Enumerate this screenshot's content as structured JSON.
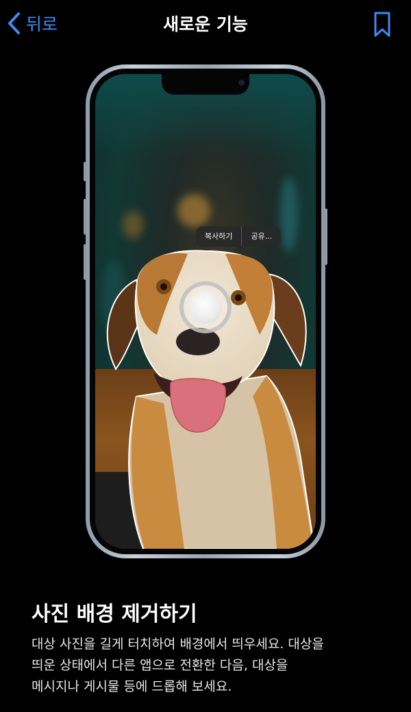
{
  "nav": {
    "back_label": "뒤로",
    "title": "새로운 기능",
    "back_icon": "chevron-left-icon",
    "bookmark_icon": "bookmark-icon",
    "accent_color": "#3c8cf6"
  },
  "phone_screen": {
    "context_menu": {
      "copy_label": "복사하기",
      "share_label": "공유..."
    }
  },
  "feature": {
    "title": "사진 배경 제거하기",
    "description_lines": [
      "대상 사진을 길게 터치하여 배경에서 띄우세요. 대상을",
      "띄운 상태에서 다른 앱으로 전환한 다음, 대상을",
      "메시지나 게시물 등에 드롭해 보세요."
    ]
  }
}
